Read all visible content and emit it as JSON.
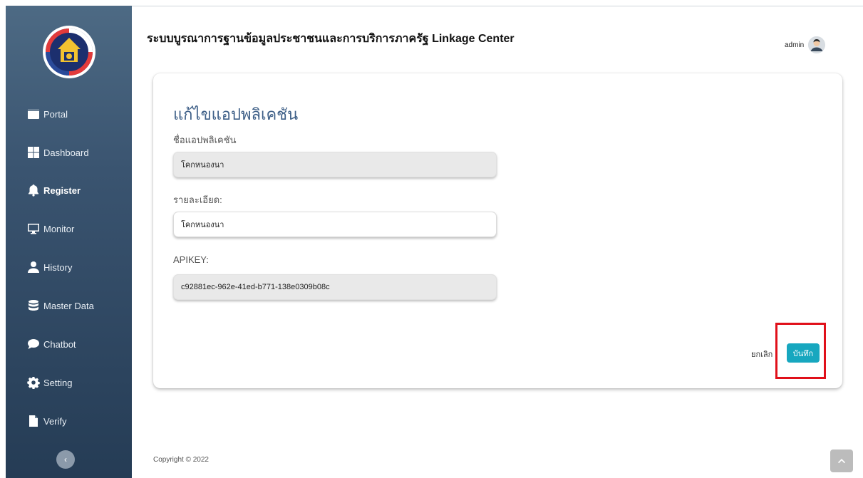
{
  "app_title": "ระบบบูรณาการฐานข้อมูลประชาชนและการบริการภาครัฐ Linkage Center",
  "user": {
    "name": "admin"
  },
  "sidebar": {
    "logo_text": "กรมการพัฒนาชุมชน",
    "items": [
      {
        "label": "Portal",
        "icon": "portal-icon"
      },
      {
        "label": "Dashboard",
        "icon": "dashboard-icon"
      },
      {
        "label": "Register",
        "icon": "bell-icon",
        "active": true
      },
      {
        "label": "Monitor",
        "icon": "monitor-icon"
      },
      {
        "label": "History",
        "icon": "user-icon"
      },
      {
        "label": "Master Data",
        "icon": "database-icon"
      },
      {
        "label": "Chatbot",
        "icon": "chat-icon"
      },
      {
        "label": "Setting",
        "icon": "gear-icon"
      },
      {
        "label": "Verify",
        "icon": "file-icon"
      }
    ]
  },
  "form": {
    "title": "แก้ไขแอปพลิเคชัน",
    "name_label": "ชื่อแอปพลิเคชัน",
    "name_value": "โคกหนองนา",
    "detail_label": "รายละเอียด:",
    "detail_value": "โคกหนองนา",
    "apikey_label": "APIKEY:",
    "apikey_value": "c92881ec-962e-41ed-b771-138e0309b08c",
    "cancel_label": "ยกเลิก",
    "save_label": "บันทึก"
  },
  "footer": {
    "copyright": "Copyright © 2022"
  },
  "colors": {
    "accent": "#17a7bf",
    "title": "#3f6088",
    "highlight": "#e0101a",
    "sidebar_top": "#4d6a84",
    "sidebar_bottom": "#253c55"
  }
}
